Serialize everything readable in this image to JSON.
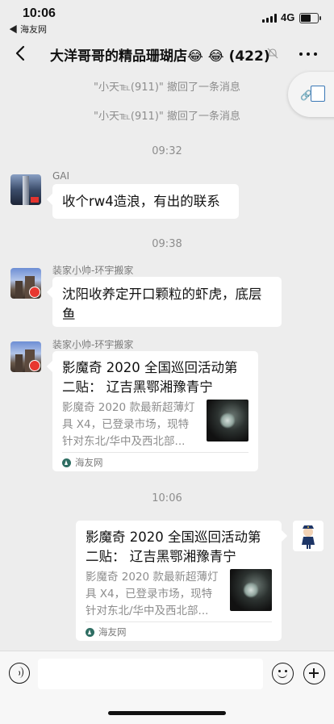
{
  "status_bar": {
    "time": "10:06",
    "back_app": "◀ 海友网",
    "network": "4G"
  },
  "navbar": {
    "title": "大洋哥哥的精品珊瑚店😂 😂 (422)"
  },
  "messages": {
    "recall_1": "\"小天℡(911)\" 撤回了一条消息",
    "recall_2": "\"小天℡(911)\" 撤回了一条消息",
    "time_1": "09:32",
    "gai_sender": "GAI",
    "gai_text": "收个rw4造浪，有出的联系",
    "time_2": "09:38",
    "zhuang_sender_1": "装家小帅-环宇搬家",
    "zhuang_text": "沈阳收养定开口颗粒的虾虎，底层鱼",
    "zhuang_sender_2": "装家小帅-环宇搬家",
    "card_1": {
      "title": "影魔奇 2020 全国巡回活动第二贴： 辽吉黑鄂湘豫青宁",
      "desc": "影魔奇 2020 款最新超薄灯具 X4，已登录市场，现特针对东北/华中及西北部...",
      "source": "海友网"
    },
    "time_3": "10:06",
    "card_2": {
      "title": "影魔奇 2020 全国巡回活动第二贴： 辽吉黑鄂湘豫青宁",
      "desc": "影魔奇 2020 款最新超薄灯具 X4，已登录市场，现特针对东北/华中及西北部...",
      "source": "海友网"
    }
  },
  "input": {
    "value": "",
    "placeholder": ""
  },
  "colors": {
    "background": "#EDEDED",
    "bubble": "#FFFFFF",
    "meta_text": "#8D8D8D"
  }
}
